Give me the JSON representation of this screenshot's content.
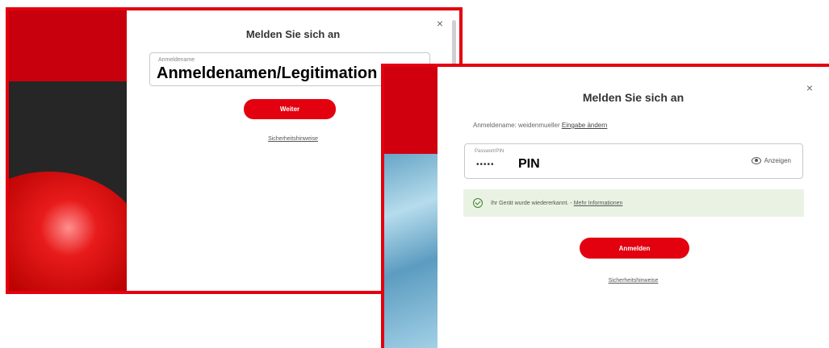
{
  "screen1": {
    "dialog_title": "Melden Sie sich an",
    "close_glyph": "×",
    "username_field": {
      "label": "Anmeldename",
      "value": "Anmeldenamen/Legitimation"
    },
    "continue_button": "Weiter",
    "security_link": "Sicherheitshinweise"
  },
  "screen2": {
    "dialog_title": "Melden Sie sich an",
    "close_glyph": "×",
    "username_line": {
      "label": "Anmeldename: weidenmueller",
      "change_link": "Eingabe ändern"
    },
    "password_field": {
      "label": "Passwort/PIN",
      "masked_value": "•••••",
      "overlay_label": "PIN",
      "show_toggle": "Anzeigen",
      "toggle_icon": "eye-icon"
    },
    "device_notice": {
      "icon": "check-circle-icon",
      "text": "Ihr Gerät wurde wiedererkannt. -",
      "more_link": "Mehr Informationen"
    },
    "login_button": "Anmelden",
    "security_link": "Sicherheitshinweise"
  },
  "colors": {
    "brand_red": "#e3000f",
    "notice_bg": "#eaf3e3",
    "notice_icon": "#3f7f2d"
  }
}
